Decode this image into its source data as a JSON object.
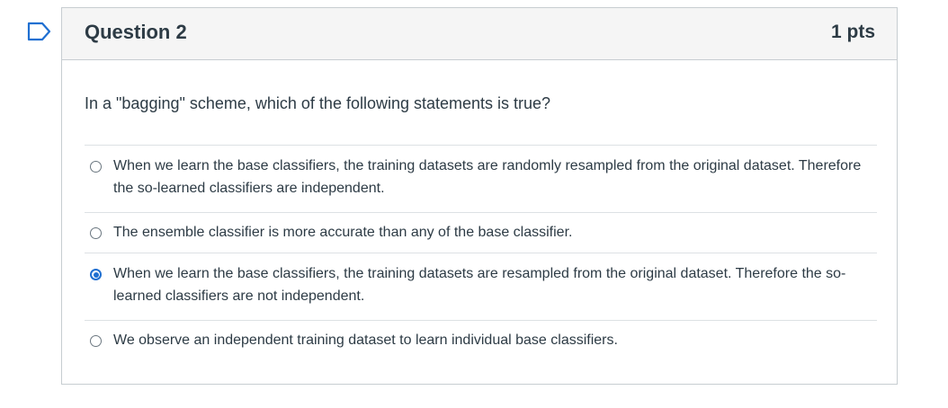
{
  "question": {
    "title": "Question 2",
    "points": "1 pts",
    "text": "In a \"bagging\" scheme, which of the following statements is true?"
  },
  "answers": [
    {
      "text": "When we learn the base classifiers, the training datasets are randomly resampled from the original dataset. Therefore the so-learned classifiers are independent.",
      "selected": false
    },
    {
      "text": "The ensemble classifier is more accurate than any of the base classifier.",
      "selected": false
    },
    {
      "text": "When we learn the base classifiers, the training datasets are resampled from the original dataset. Therefore the so-learned classifiers are not independent.",
      "selected": true
    },
    {
      "text": "We observe an independent training dataset to learn individual base classifiers.",
      "selected": false
    }
  ],
  "colors": {
    "accent": "#1f6fd1",
    "border": "#c7cdd1",
    "header_bg": "#f5f5f5",
    "text": "#2d3b45"
  },
  "icons": {
    "flag": "flag-outline-icon"
  }
}
